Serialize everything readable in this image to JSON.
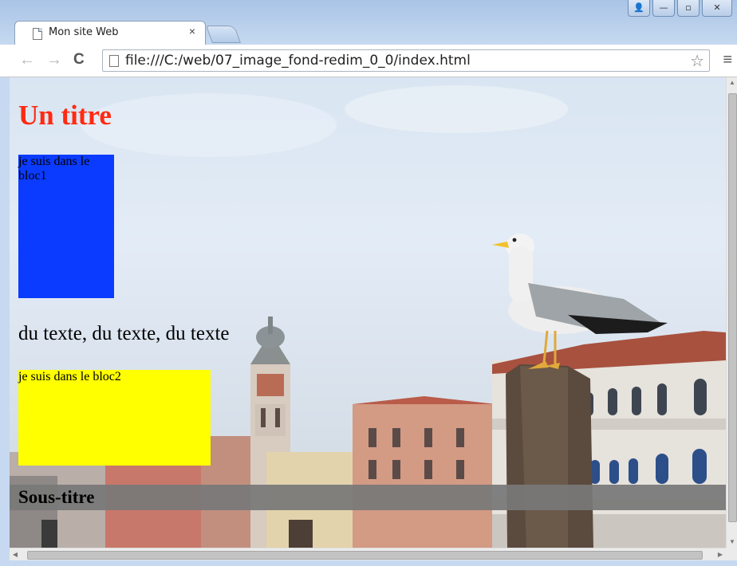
{
  "browser": {
    "tab_title": "Mon site Web",
    "tab_close": "×",
    "url": "file:///C:/web/07_image_fond-redim_0_0/index.html",
    "nav_back": "←",
    "nav_forward": "→",
    "reload": "C",
    "star": "☆",
    "menu": "≡",
    "window_controls": {
      "user": "👤",
      "minimize": "—",
      "maximize": "▫",
      "close": "✕"
    }
  },
  "page": {
    "title": "Un titre",
    "bloc1_text": "je suis dans le bloc1",
    "body_text": "du texte, du texte, du texte",
    "bloc2_text": "je suis dans le bloc2",
    "subtitle": "Sous-titre"
  },
  "colors": {
    "title": "#ff2a12",
    "bloc1": "#0a3bff",
    "bloc2": "#ffff00",
    "subtitle_band": "#787878"
  }
}
